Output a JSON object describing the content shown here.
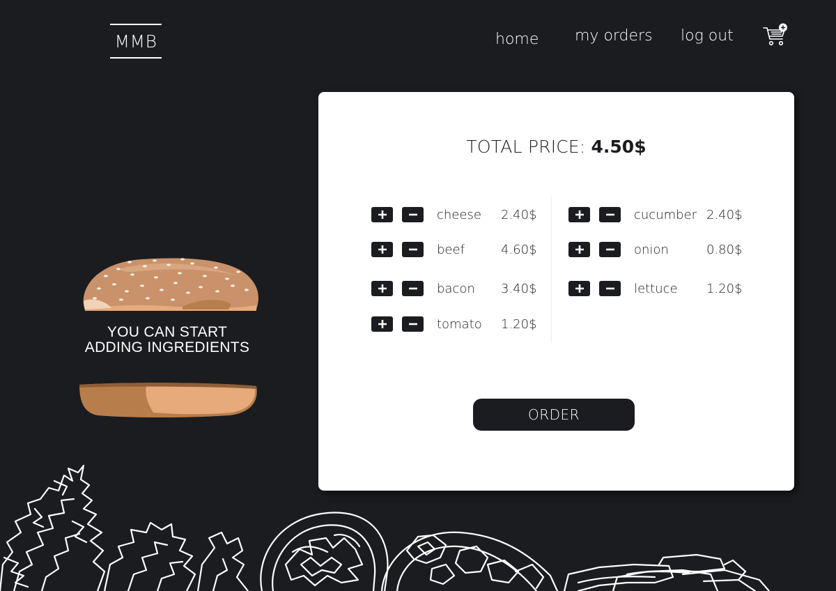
{
  "header": {
    "logo": "MMB",
    "nav": {
      "home": "home",
      "my_orders": "my orders",
      "log_out": "log out"
    },
    "cart_icon": "cart-plus-icon"
  },
  "hero": {
    "hint_line1": "YOU CAN START",
    "hint_line2": "ADDING INGREDIENTS"
  },
  "order": {
    "total_label": "TOTAL PRICE:",
    "total_value": "4.50$",
    "order_button": "ORDER",
    "left_ingredients": [
      {
        "name": "cheese",
        "price": "2.40$"
      },
      {
        "name": "beef",
        "price": "4.60$"
      },
      {
        "name": "bacon",
        "price": "3.40$"
      },
      {
        "name": "tomato",
        "price": "1.20$"
      }
    ],
    "right_ingredients": [
      {
        "name": "cucumber",
        "price": "2.40$"
      },
      {
        "name": "onion",
        "price": "0.80$"
      },
      {
        "name": "lettuce",
        "price": "1.20$"
      }
    ]
  },
  "colors": {
    "background": "#1b1c1f",
    "card": "#ffffff",
    "bun_light": "#e7aa7b",
    "bun_dark": "#b77d4b"
  }
}
